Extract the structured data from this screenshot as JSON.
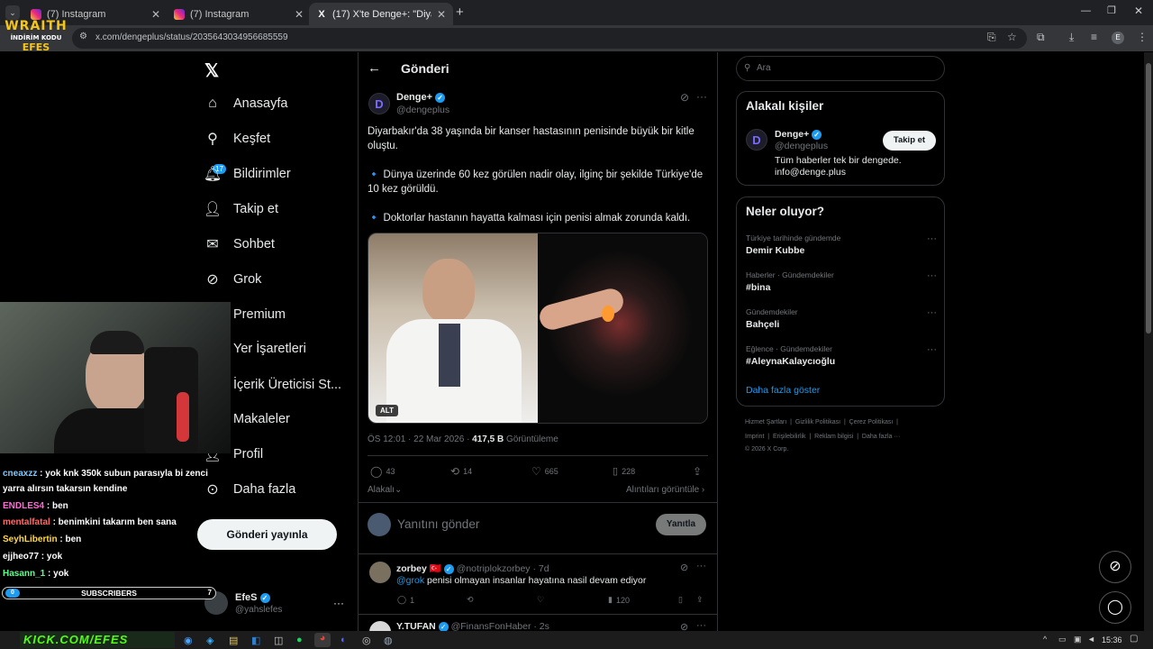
{
  "browser": {
    "tabs": [
      {
        "title": "(7) Instagram"
      },
      {
        "title": "(7) Instagram"
      },
      {
        "title": "(17) X'te Denge+: \"Diyarbakır'd"
      }
    ],
    "url": "x.com/dengeplus/status/2035643034956685559"
  },
  "overlay": {
    "wraith_title": "WRAITH",
    "wraith_sub": "İNDİRİM KODU",
    "wraith_code": "EFES",
    "subscribers_label": "SUBSCRIBERS",
    "subscribers_left": "0",
    "subscribers_right": "7",
    "kick_text": "KICK.COM/EFES",
    "chat": [
      {
        "user": "cneaxzz",
        "text": " : yok knk 350k subun parasıyla bi zenci",
        "color": "#7ec8ff"
      },
      {
        "user": "",
        "text": "yarra alırsın takarsın kendine",
        "color": "#fff"
      },
      {
        "user": "ENDLES4",
        "text": " : ben",
        "color": "#ff6bd6"
      },
      {
        "user": "mentalfatal",
        "text": " : benimkini takarım ben sana",
        "color": "#ff6b6b"
      },
      {
        "user": "SeyhLibertin",
        "text": " : ben",
        "color": "#ffd94a"
      },
      {
        "user": "ejjheo77",
        "text": " : yok",
        "color": "#fff"
      },
      {
        "user": "Hasann_1",
        "text": " : yok",
        "color": "#5cff8a"
      }
    ]
  },
  "nav": {
    "items": [
      {
        "label": "Anasayfa",
        "icon": "home-icon",
        "glyph": "⌂"
      },
      {
        "label": "Keşfet",
        "icon": "search-icon",
        "glyph": "⚲"
      },
      {
        "label": "Bildirimler",
        "icon": "bell-icon",
        "glyph": "🔔︎",
        "badge": "17"
      },
      {
        "label": "Takip et",
        "icon": "person-add-icon",
        "glyph": "👤︎"
      },
      {
        "label": "Sohbet",
        "icon": "mail-icon",
        "glyph": "✉"
      },
      {
        "label": "Grok",
        "icon": "grok-icon",
        "glyph": "⊘"
      },
      {
        "label": "Premium",
        "icon": "x-premium-icon",
        "glyph": "X"
      },
      {
        "label": "Yer İşaretleri",
        "icon": "bookmark-icon",
        "glyph": "🔖︎"
      },
      {
        "label": "İçerik Üreticisi St...",
        "icon": "studio-icon",
        "glyph": "▣"
      },
      {
        "label": "Makaleler",
        "icon": "articles-icon",
        "glyph": "☰"
      },
      {
        "label": "Profil",
        "icon": "profile-icon",
        "glyph": "👤︎"
      },
      {
        "label": "Daha fazla",
        "icon": "more-circle-icon",
        "glyph": "⊙"
      }
    ],
    "post_button": "Gönderi yayınla",
    "account_name": "EfeS",
    "account_handle": "@yahslefes"
  },
  "post": {
    "header": "Gönderi",
    "author_name": "Denge+",
    "author_handle": "@dengeplus",
    "text_1": "Diyarbakır'da 38 yaşında bir kanser hastasının penisinde büyük bir kitle oluştu.",
    "text_2": "🔹 Dünya üzerinde 60 kez görülen nadir olay, ilginç bir şekilde Türkiye'de 10 kez görüldü.",
    "text_3": "🔹 Doktorlar hastanın hayatta kalması için penisi almak zorunda kaldı.",
    "alt_badge": "ALT",
    "time": "ÖS 12:01 · 22 Mar 2026 · ",
    "views_count": "417,5 B",
    "views_label": " Görüntüleme",
    "replies": "43",
    "reposts": "14",
    "likes": "665",
    "bookmarks": "228",
    "relevant": "Alakalı",
    "quotes_link": "Alıntıları görüntüle ›",
    "reply_placeholder": "Yanıtını gönder",
    "reply_button": "Yanıtla"
  },
  "replies": [
    {
      "name": "zorbey 🇹🇷",
      "handle": "@notriplokzorbey · 7d",
      "mention": "@grok",
      "text": " penisi olmayan insanlar hayatına nasil devam ediyor",
      "replies": "1",
      "views": "120"
    },
    {
      "name": "Y.TUFAN",
      "handle": "@FinansFonHaber · 2s"
    }
  ],
  "sidebar": {
    "search_placeholder": "Ara",
    "who_title": "Alakalı kişiler",
    "who_name": "Denge+",
    "who_handle": "@dengeplus",
    "who_bio": "Tüm haberler tek bir dengede. info@denge.plus",
    "follow_button": "Takip et",
    "trends_title": "Neler oluyor?",
    "trends": [
      {
        "context": "Türkiye tarihinde gündemde",
        "topic": "Demir Kubbe"
      },
      {
        "context": "Haberler · Gündemdekiler",
        "topic": "#bina"
      },
      {
        "context": "Gündemdekiler",
        "topic": "Bahçeli"
      },
      {
        "context": "Eğlence · Gündemdekiler",
        "topic": "#AleynaKalaycıoğlu"
      }
    ],
    "show_more": "Daha fazla göster",
    "footer_1": "Hizmet Şartları  |  Gizlilik Politikası  |  Çerez Politikası  |",
    "footer_2": "Imprint  |  Erişilebilirlik  |  Reklam bilgisi  |  Daha fazla ···",
    "footer_3": "© 2026 X Corp."
  },
  "taskbar": {
    "time": "15:36"
  },
  "colors": {
    "accent": "#1d9bf0",
    "kick": "#53fc18",
    "wraith": "#f5c518"
  }
}
